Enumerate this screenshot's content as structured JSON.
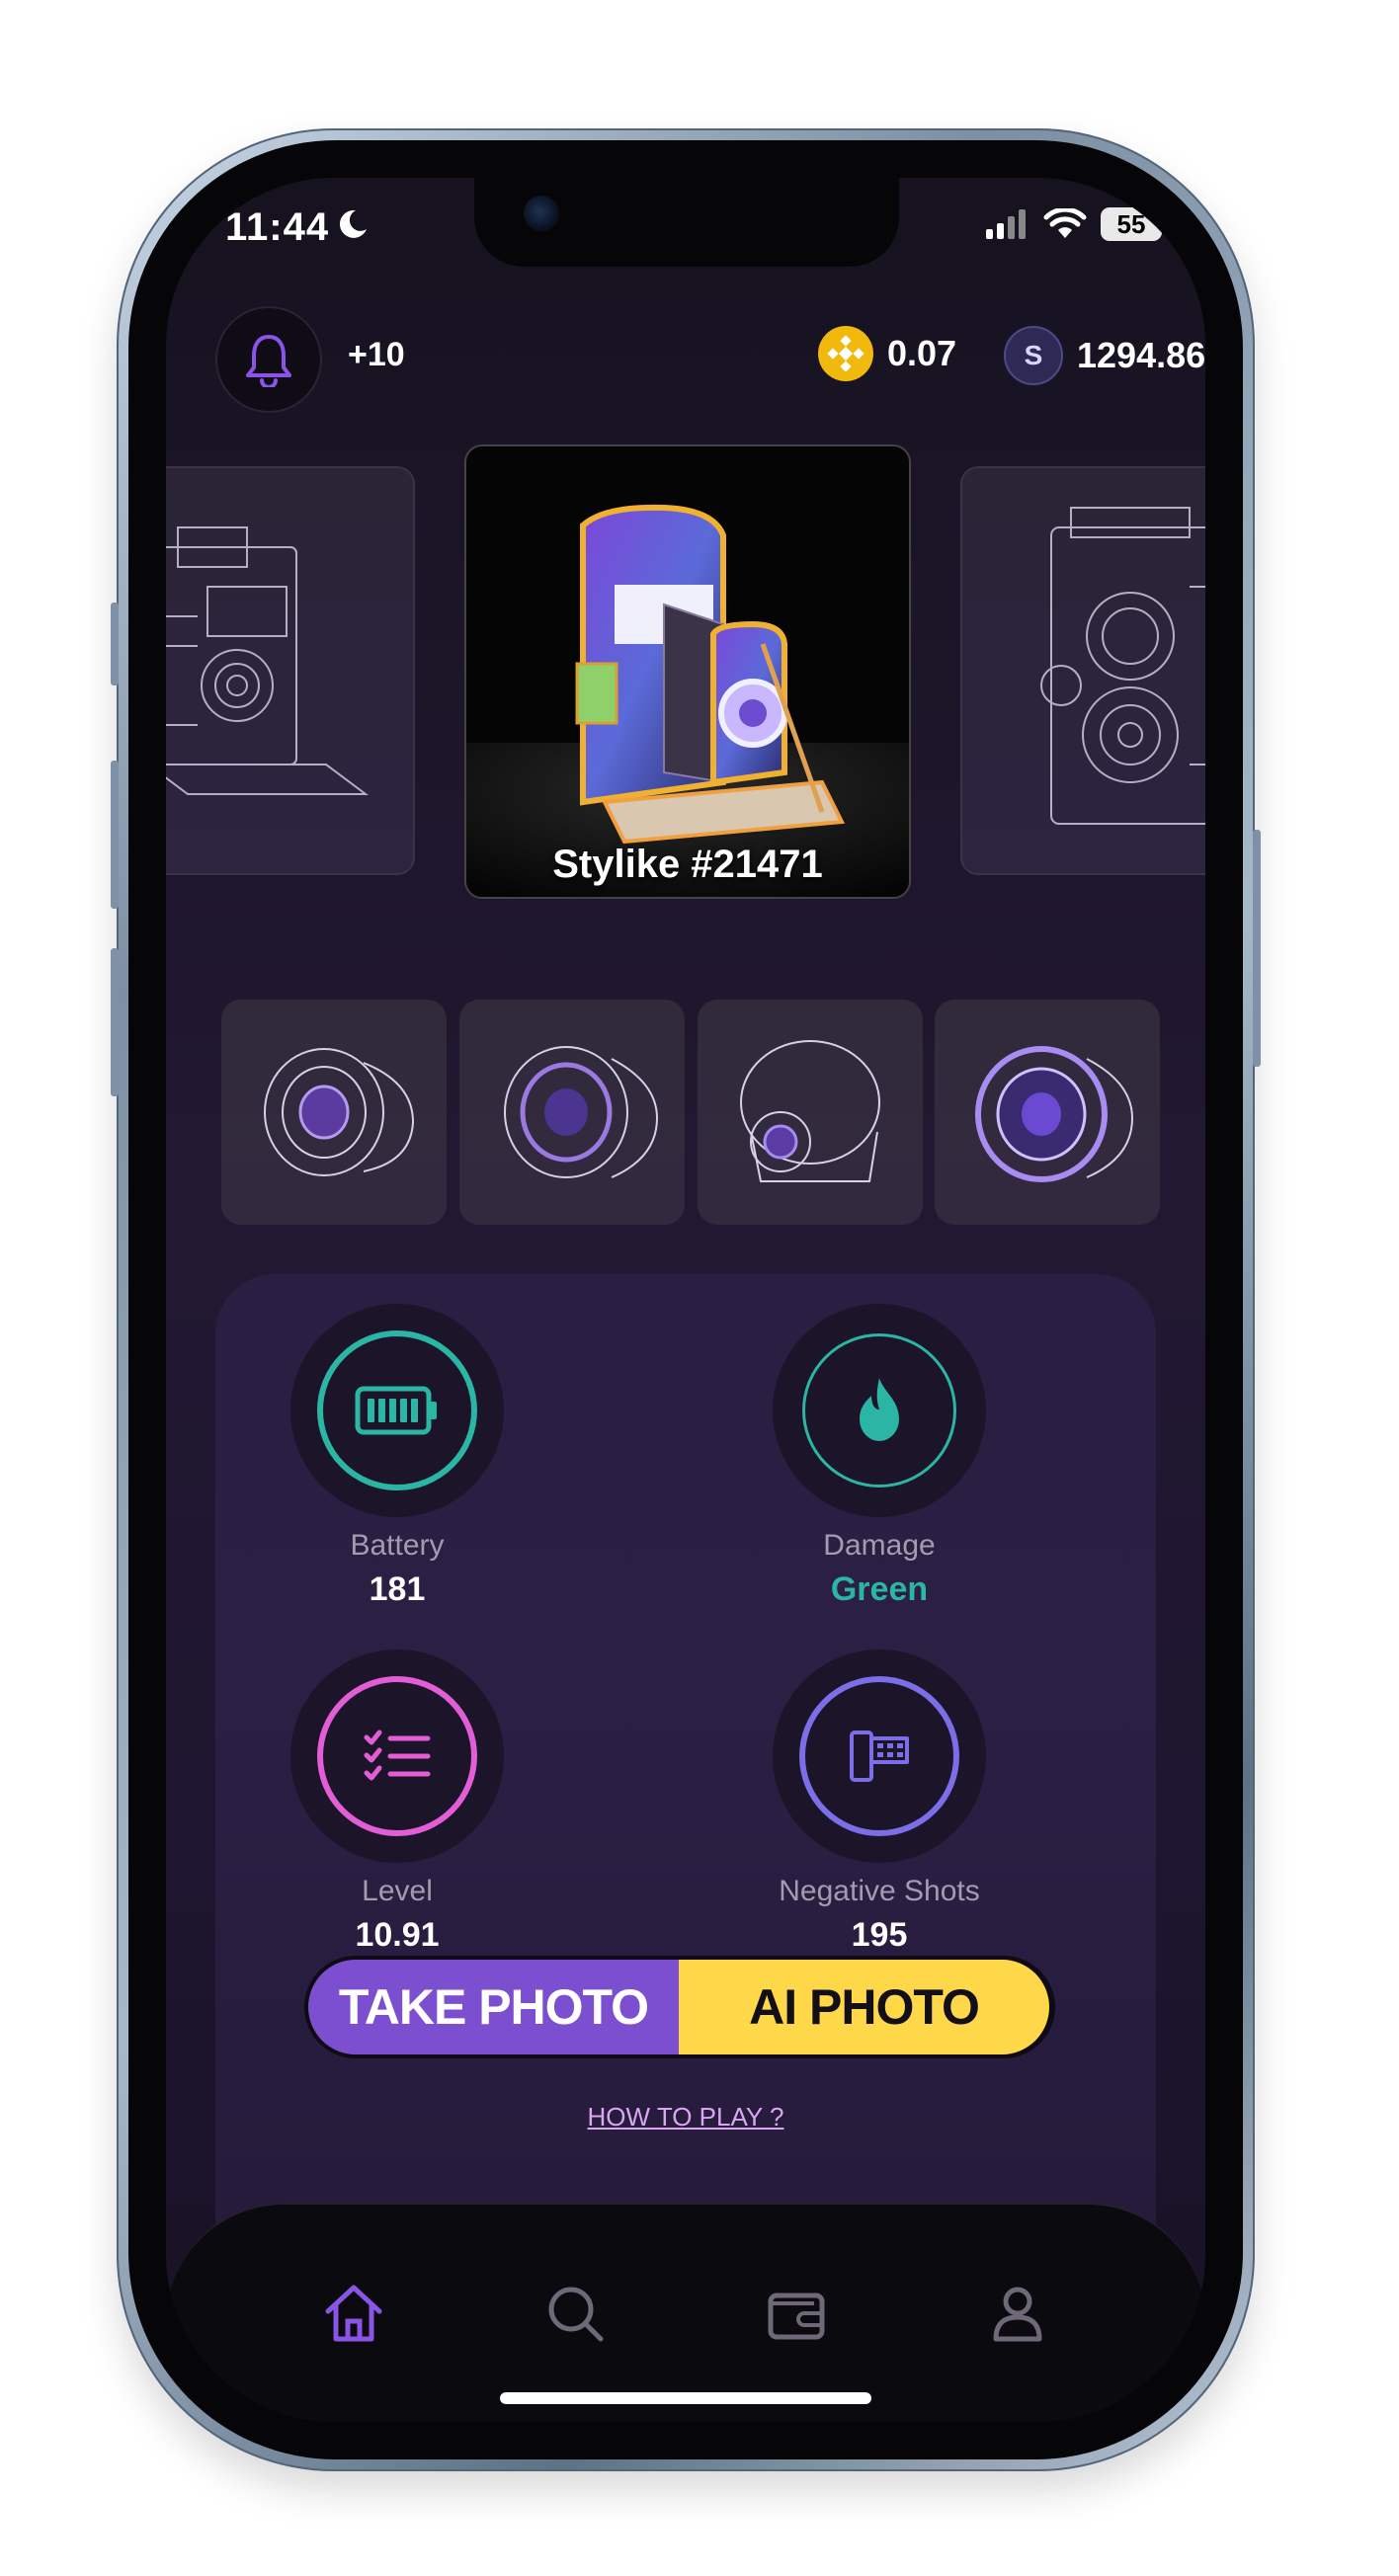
{
  "status_bar": {
    "time": "11:44",
    "battery_level": "55"
  },
  "header": {
    "notification_count": "+10",
    "bnb_balance": "0.07",
    "s_balance": "1294.86",
    "s_coin_letter": "S"
  },
  "camera": {
    "name": "Stylike #21471"
  },
  "stats": {
    "battery": {
      "label": "Battery",
      "value": "181",
      "color": "#2bb5a5"
    },
    "damage": {
      "label": "Damage",
      "value": "Green",
      "color": "#2bb5a5"
    },
    "level": {
      "label": "Level",
      "value": "10.91",
      "color": "#e35ed6"
    },
    "negative_shots": {
      "label": "Negative Shots",
      "value": "195",
      "color": "#7b6ee8"
    }
  },
  "actions": {
    "take_photo": "TAKE PHOTO",
    "ai_photo": "AI PHOTO",
    "how_to_play": "HOW TO PLAY ?"
  },
  "tabs": [
    {
      "name": "home",
      "icon": "home-icon",
      "active": true
    },
    {
      "name": "search",
      "icon": "search-icon",
      "active": false
    },
    {
      "name": "wallet",
      "icon": "wallet-icon",
      "active": false
    },
    {
      "name": "profile",
      "icon": "profile-icon",
      "active": false
    }
  ],
  "colors": {
    "accent_purple": "#7c4fd0",
    "accent_yellow": "#ffd84a",
    "teal": "#2bb5a5",
    "background": "#1b1527"
  }
}
